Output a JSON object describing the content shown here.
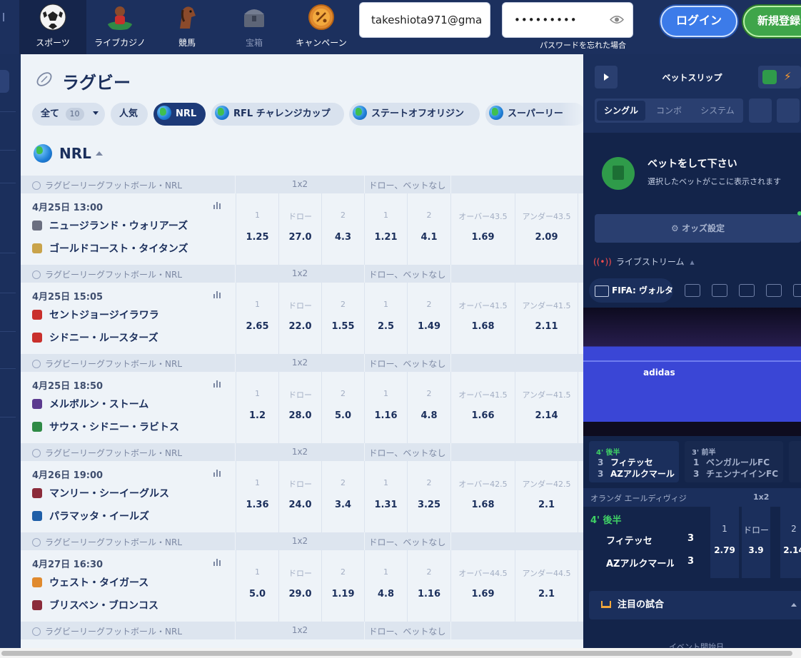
{
  "nav": {
    "items": [
      {
        "label": "スポーツ",
        "icon": "soccer-ball-icon",
        "active": true
      },
      {
        "label": "ライブカジノ",
        "icon": "casino-dealer-icon"
      },
      {
        "label": "競馬",
        "icon": "horse-icon"
      },
      {
        "label": "宝箱",
        "icon": "treasure-chest-icon"
      },
      {
        "label": "キャンペーン",
        "icon": "percent-medal-icon"
      }
    ],
    "email_value": "takeshiota971@gma",
    "password_value": "•••••••••",
    "forgot_password": "パスワードを忘れた場合",
    "login_label": "ログイン",
    "register_label": "新規登録"
  },
  "page": {
    "title": "ラグビー",
    "filters": [
      {
        "label": "全て",
        "count": "10"
      },
      {
        "label": "人気"
      },
      {
        "label": "NRL",
        "active": true
      },
      {
        "label": "RFL チャレンジカップ"
      },
      {
        "label": "ステートオフオリジン"
      },
      {
        "label": "スーパーリー"
      }
    ],
    "league": "NRL"
  },
  "markets": {
    "competition": "ラグビーリーグフットボール・NRL",
    "group_1x2": "1x2",
    "group_dnb": "ドロー、ベットなし",
    "labels": [
      "1",
      "ドロー",
      "2",
      "1",
      "2"
    ]
  },
  "matches": [
    {
      "time": "4月25日 13:00",
      "home": "ニュージランド・ウォリアーズ",
      "away": "ゴールドコースト・タイタンズ",
      "over": "オーバー43.5",
      "under": "アンダー43.5",
      "odds": [
        "1.25",
        "27.0",
        "4.3",
        "1.21",
        "4.1",
        "1.69",
        "2.09"
      ]
    },
    {
      "time": "4月25日 15:05",
      "home": "セントジョージイラワラ",
      "away": "シドニー・ルースターズ",
      "over": "オーバー41.5",
      "under": "アンダー41.5",
      "odds": [
        "2.65",
        "22.0",
        "1.55",
        "2.5",
        "1.49",
        "1.68",
        "2.11"
      ]
    },
    {
      "time": "4月25日 18:50",
      "home": "メルボルン・ストーム",
      "away": "サウス・シドニー・ラビトス",
      "over": "オーバー41.5",
      "under": "アンダー41.5",
      "odds": [
        "1.2",
        "28.0",
        "5.0",
        "1.16",
        "4.8",
        "1.66",
        "2.14"
      ]
    },
    {
      "time": "4月26日 19:00",
      "home": "マンリー・シーイーグルス",
      "away": "パラマッタ・イールズ",
      "over": "オーバー42.5",
      "under": "アンダー42.5",
      "odds": [
        "1.36",
        "24.0",
        "3.4",
        "1.31",
        "3.25",
        "1.68",
        "2.1"
      ]
    },
    {
      "time": "4月27日 16:30",
      "home": "ウェスト・タイガース",
      "away": "ブリスベン・ブロンコス",
      "over": "オーバー44.5",
      "under": "アンダー44.5",
      "odds": [
        "5.0",
        "29.0",
        "1.19",
        "4.8",
        "1.16",
        "1.69",
        "2.1"
      ]
    }
  ],
  "betslip": {
    "title": "ベットスリップ",
    "tabs": [
      "シングル",
      "コンボ",
      "システム"
    ],
    "empty_title": "ベットをして下さい",
    "empty_sub": "選択したベットがここに表示されます",
    "odds_settings": "オッズ設定"
  },
  "live": {
    "header": "ライブストリーム",
    "active_sport": "FIFA: ヴォルタ",
    "court_logo": "adidas",
    "cards": [
      {
        "status": "4' 後半",
        "home_score": "3",
        "home": "フィテッセ",
        "away_score": "3",
        "away": "AZアルクマール"
      },
      {
        "status": "3' 前半",
        "home_score": "1",
        "home": "ベンガルールFC",
        "away_score": "3",
        "away": "チェンナイインFC"
      }
    ],
    "match": {
      "league": "オランダ エールディヴィジ",
      "market": "1x2",
      "status": "4' 後半",
      "home": "フィテッセ",
      "home_score": "3",
      "away": "AZアルクマール",
      "away_score": "3",
      "labels": [
        "1",
        "ドロー",
        "2"
      ],
      "odds": [
        "2.79",
        "3.9",
        "2.14"
      ]
    },
    "featured": "注目の試合",
    "event_start": "イベント開始日"
  },
  "colors": {
    "navy": "#1b2f5c",
    "accent_blue": "#3c7be9",
    "green": "#3fa54a",
    "live_green": "#3fd065"
  }
}
